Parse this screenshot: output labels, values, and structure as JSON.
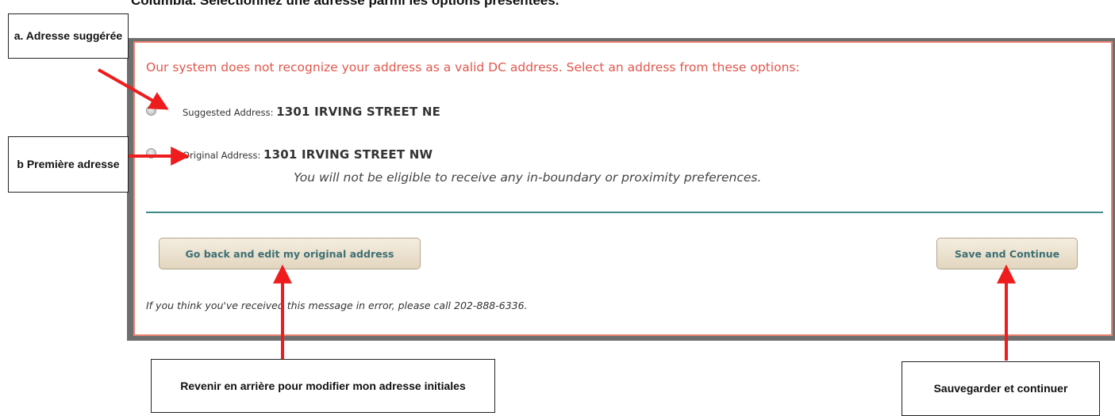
{
  "document": {
    "heading_partial": "Columbia. Sélectionnez une adresse parmi les options présentées."
  },
  "dialog": {
    "title": "Our system does not recognize your address as a valid DC address. Select an address from these options:",
    "options": [
      {
        "label": "Suggested Address:",
        "value": "1301 IRVING STREET NE"
      },
      {
        "label": "Original Address:",
        "value": "1301 IRVING STREET NW"
      }
    ],
    "original_note": "You will not be eligible to receive any in-boundary or proximity preferences.",
    "back_button": "Go back and edit my original address",
    "save_button": "Save and Continue",
    "footer": "If you think you've received this message in error, please call 202-888-6336."
  },
  "callouts": {
    "suggested": "a. Adresse suggérée",
    "original": "b  Première adresse",
    "back": "Revenir en arrière pour modifier mon adresse initiales",
    "save": "Sauvegarder et continuer"
  },
  "colors": {
    "title_red": "#e2574c",
    "dialog_border": "#e8836f",
    "divider_teal": "#3d8a8a",
    "button_text": "#3d6f72",
    "arrow_red": "#ee1c1c"
  }
}
